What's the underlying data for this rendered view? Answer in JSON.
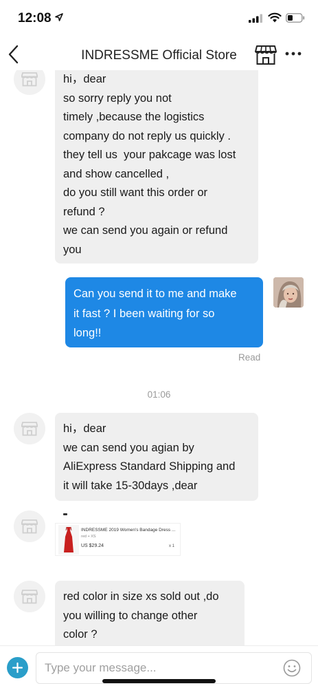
{
  "status_bar": {
    "time": "12:08",
    "icons": [
      "location-arrow-icon",
      "signal-icon",
      "wifi-icon",
      "battery-icon"
    ]
  },
  "header": {
    "title": "INDRESSME Official Store",
    "icons": [
      "back-chevron-icon",
      "store-icon",
      "more-icon"
    ]
  },
  "messages": [
    {
      "sender": "store",
      "lines": [
        "hi，dear",
        "so sorry reply you not",
        "timely ,because the logistics",
        "company do not reply us quickly .",
        "they tell us  your pakcage was lost",
        "and show cancelled ,",
        "do you still want this order or",
        "refund ?",
        "we can send you again or refund",
        "you"
      ]
    },
    {
      "sender": "user",
      "lines": [
        "Can you send it to me and make",
        "it fast ? I been waiting for so",
        "long!!"
      ],
      "status": "Read"
    },
    {
      "sender": "store",
      "lines": [
        "hi，dear",
        "we can send you agian by",
        "AliExpress Standard Shipping and",
        "it will take 15-30days ,dear"
      ]
    },
    {
      "sender": "store",
      "type": "product",
      "title": "INDRESSME 2019 Women's Bandage Dress ...",
      "variant": "red + XS",
      "price": "US $29.24",
      "quantity": "x 1"
    },
    {
      "sender": "store",
      "lines": [
        "red color in size xs sold out ,do",
        "you willing to change other",
        "color ?"
      ]
    }
  ],
  "timestamp": "01:06",
  "composer": {
    "placeholder": "Type your message...",
    "icons": [
      "plus-icon",
      "emoji-icon"
    ]
  },
  "colors": {
    "accent": "#1e88e5",
    "incoming_bubble": "#efefef",
    "plus_button": "#2a9ec9",
    "product_dress": "#c8201f"
  }
}
